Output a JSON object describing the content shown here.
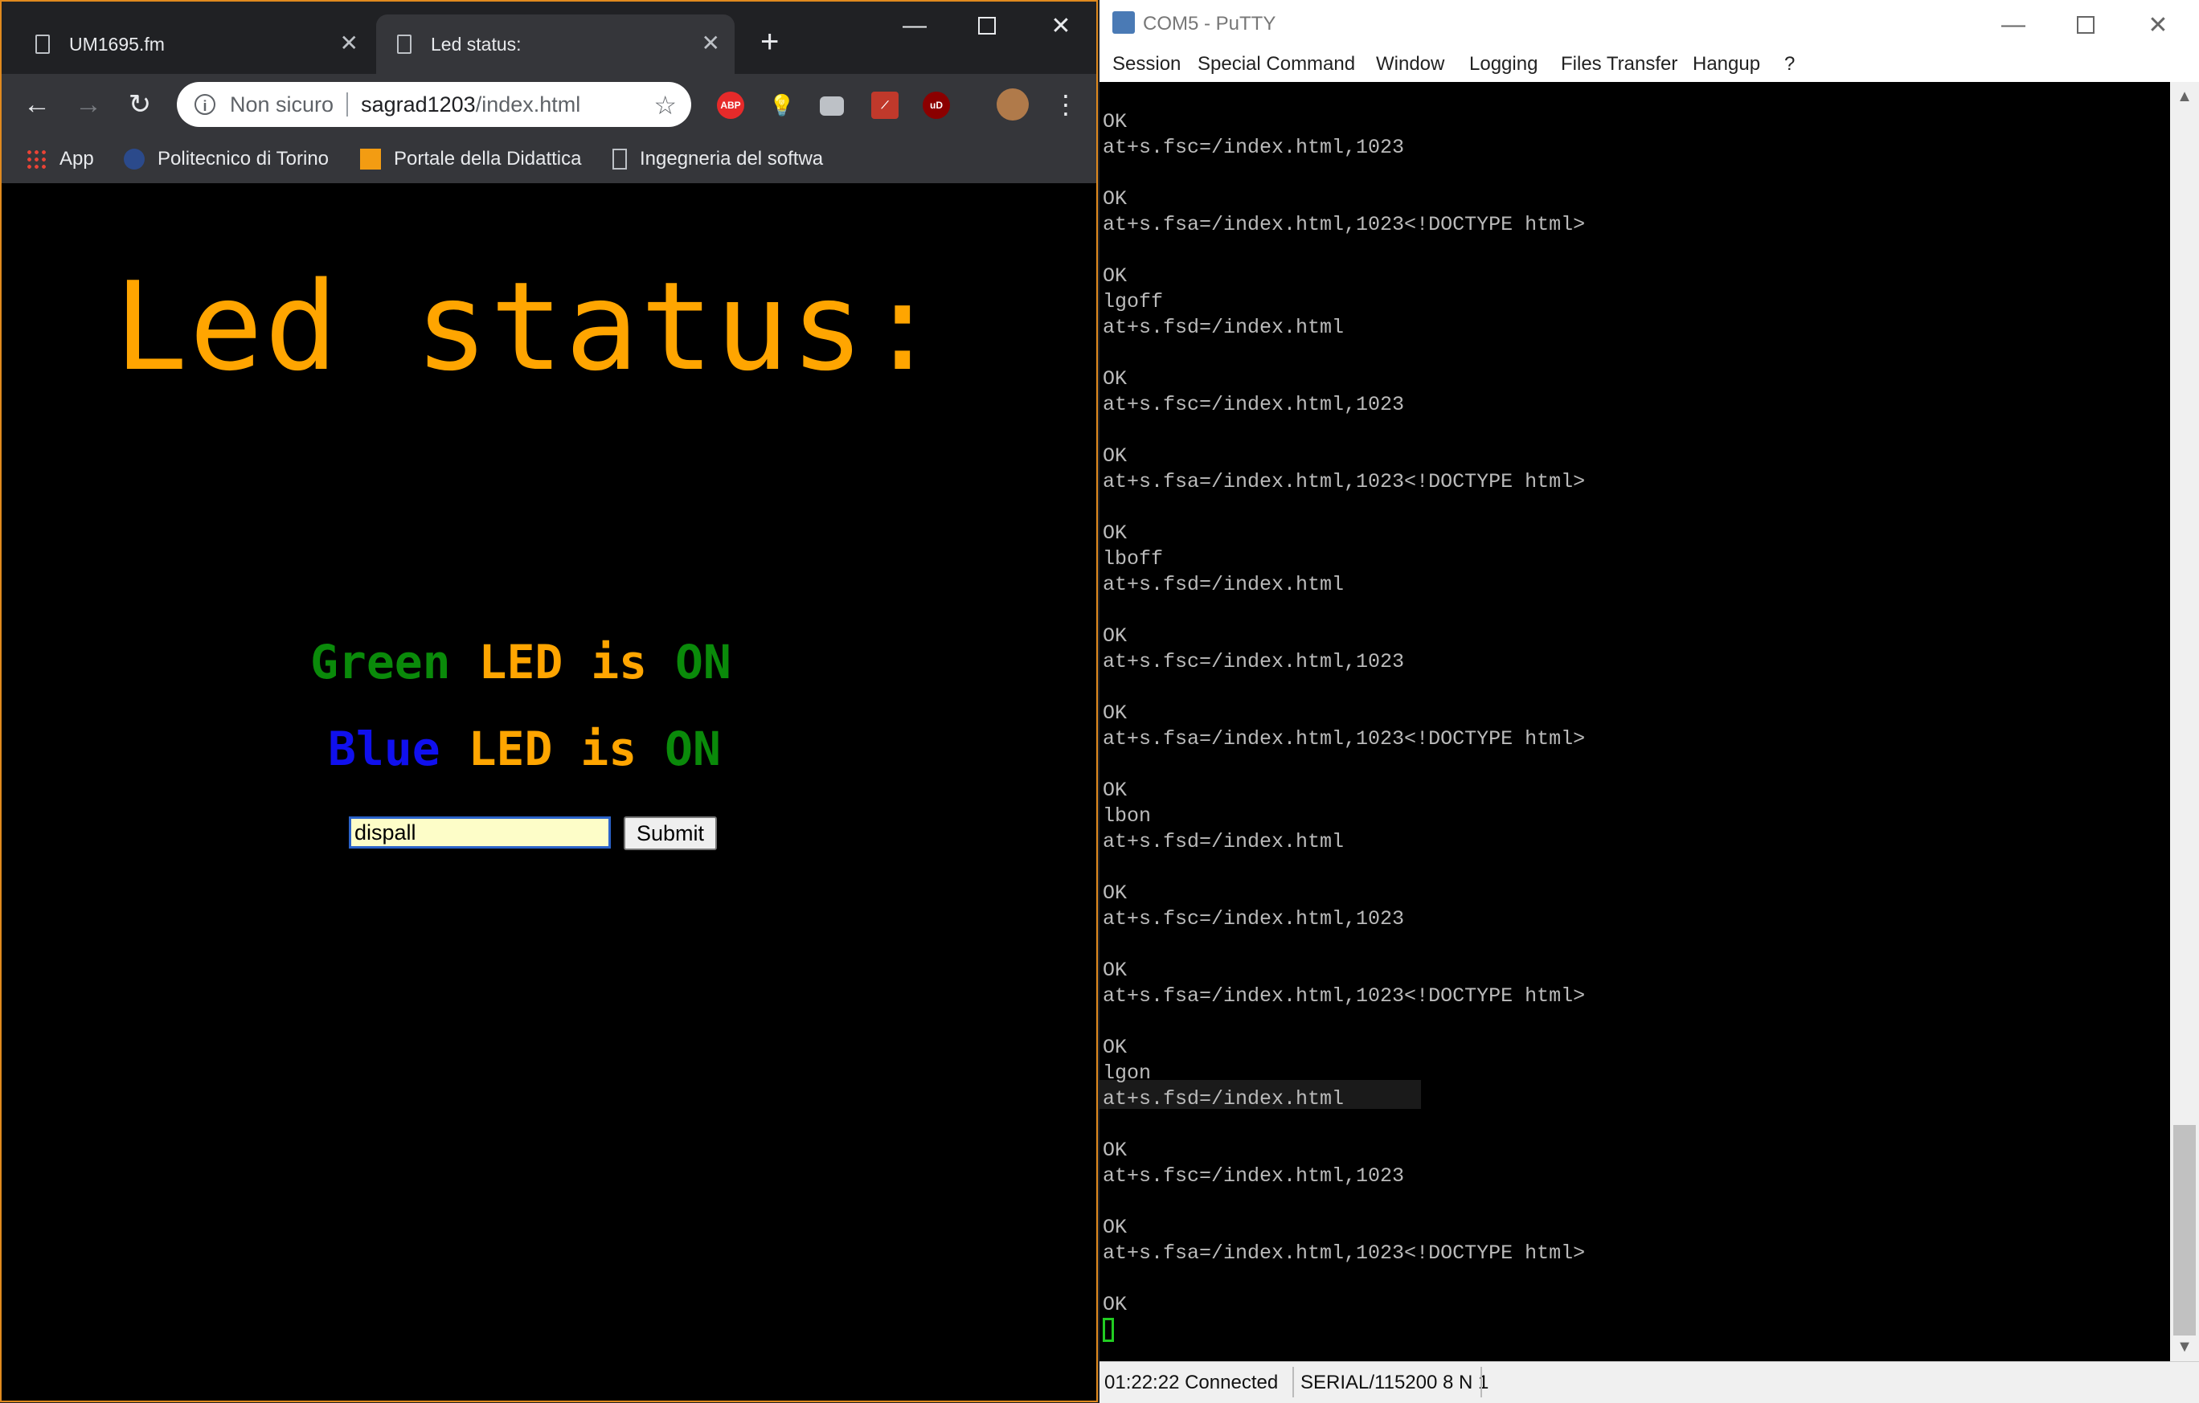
{
  "browser": {
    "tabs": [
      {
        "title": "UM1695.fm",
        "active": false
      },
      {
        "title": "Led status:",
        "active": true
      }
    ],
    "url": {
      "security": "Non sicuro",
      "host": "sagrad1203",
      "path": "/index.html"
    },
    "bookmarks": [
      {
        "label": "App",
        "icon": "apps-grid-icon"
      },
      {
        "label": "Politecnico di Torino",
        "icon": "polito-logo-icon"
      },
      {
        "label": "Portale della Didattica",
        "icon": "didattica-logo-icon"
      },
      {
        "label": "Ingegneria del softwa",
        "icon": "page-icon"
      }
    ],
    "extensions": [
      {
        "name": "adblock-plus-icon",
        "label": "ABP",
        "color": "#e62a2a"
      },
      {
        "name": "lightbulb-icon",
        "color": "#bdc1c6"
      },
      {
        "name": "camera-icon",
        "color": "#bdc1c6"
      },
      {
        "name": "pdf-icon",
        "color": "#c0392b"
      },
      {
        "name": "ublock-icon",
        "label": "uD",
        "color": "#8b0000"
      }
    ]
  },
  "page": {
    "title": "Led status:",
    "green_status": {
      "color_word": "Green",
      "rest": "LED is",
      "state": "ON"
    },
    "blue_status": {
      "color_word": "Blue",
      "rest": "LED is",
      "state": "ON"
    },
    "input_value": "dispall",
    "submit_label": "Submit",
    "colors": {
      "title": "#ffa500",
      "green": "#0a8a0a",
      "blue": "#1010ee",
      "on": "#0a8a0a"
    }
  },
  "putty": {
    "title": "COM5 - PuTTY",
    "menu": [
      "Session",
      "Special Command",
      "Window",
      "Logging",
      "Files Transfer",
      "Hangup",
      "?"
    ],
    "terminal_lines": [
      "OK",
      "at+s.fsc=/index.html,1023",
      "",
      "OK",
      "at+s.fsa=/index.html,1023<!DOCTYPE html>",
      "",
      "OK",
      "lgoff",
      "at+s.fsd=/index.html",
      "",
      "OK",
      "at+s.fsc=/index.html,1023",
      "",
      "OK",
      "at+s.fsa=/index.html,1023<!DOCTYPE html>",
      "",
      "OK",
      "lboff",
      "at+s.fsd=/index.html",
      "",
      "OK",
      "at+s.fsc=/index.html,1023",
      "",
      "OK",
      "at+s.fsa=/index.html,1023<!DOCTYPE html>",
      "",
      "OK",
      "lbon",
      "at+s.fsd=/index.html",
      "",
      "OK",
      "at+s.fsc=/index.html,1023",
      "",
      "OK",
      "at+s.fsa=/index.html,1023<!DOCTYPE html>",
      "",
      "OK",
      "lgon",
      "at+s.fsd=/index.html",
      "",
      "OK",
      "at+s.fsc=/index.html,1023",
      "",
      "OK",
      "at+s.fsa=/index.html,1023<!DOCTYPE html>",
      "",
      "OK"
    ],
    "status_connection": "01:22:22 Connected",
    "status_serial": "SERIAL/115200 8 N 1"
  }
}
